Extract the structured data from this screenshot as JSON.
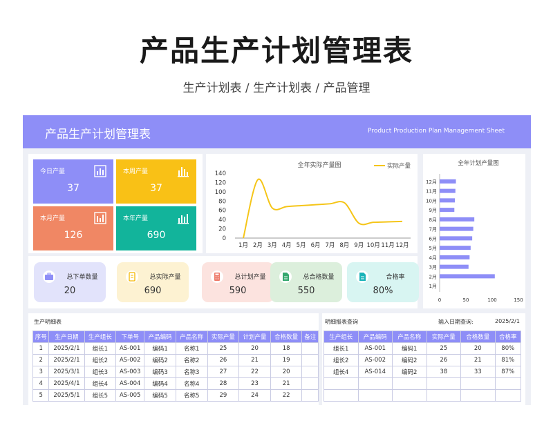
{
  "page": {
    "title": "产品生产计划管理表",
    "breadcrumb": [
      "生产计划表",
      "/",
      "生产计划表",
      "/",
      "产品管理"
    ]
  },
  "banner": {
    "title": "产品生产计划管理表",
    "subtitle": "Product Production Plan Management Sheet"
  },
  "stats": [
    {
      "label": "今日产量",
      "value": "37",
      "color": "#8e8ef7"
    },
    {
      "label": "本周产量",
      "value": "37",
      "color": "#f9c116"
    },
    {
      "label": "本月产量",
      "value": "126",
      "color": "#f08764"
    },
    {
      "label": "本年产量",
      "value": "690",
      "color": "#12b49b"
    }
  ],
  "kpis": [
    {
      "label": "总下单数量",
      "value": "20",
      "bg": "#e2e3fb",
      "icon_color": "#8e8ef7",
      "icon": "briefcase-icon"
    },
    {
      "label": "总实际产量",
      "value": "690",
      "bg": "#fdf2d2",
      "icon_color": "#f5b800",
      "icon": "document-icon"
    },
    {
      "label": "总计划产量",
      "value": "590",
      "bg": "#fce3df",
      "icon_color": "#ee7a6a",
      "icon": "calculator-icon"
    },
    {
      "label": "总合格数量",
      "value": "550",
      "bg": "#dcefdc",
      "icon_color": "#36a86f",
      "icon": "file-icon"
    },
    {
      "label": "合格率",
      "value": "80%",
      "bg": "#d8f5f2",
      "icon_color": "#1ab3b8",
      "icon": "file-icon"
    }
  ],
  "chart_data": [
    {
      "type": "line",
      "title": "全年实际产量图",
      "legend": "实际产量",
      "legend_position": "top-right",
      "color": "#f5c518",
      "x": [
        "1月",
        "2月",
        "3月",
        "4月",
        "5月",
        "6月",
        "7月",
        "8月",
        "9月",
        "10月",
        "11月",
        "12月"
      ],
      "values": [
        0,
        126,
        65,
        68,
        70,
        72,
        74,
        76,
        32,
        34,
        35,
        36
      ],
      "ylim": [
        0,
        140
      ],
      "yticks": [
        0,
        20,
        40,
        60,
        80,
        100,
        120,
        140
      ]
    },
    {
      "type": "bar",
      "orientation": "horizontal",
      "title": "全年计划产量图",
      "color": "#8e8ef7",
      "categories": [
        "1月",
        "2月",
        "3月",
        "4月",
        "5月",
        "6月",
        "7月",
        "8月",
        "9月",
        "10月",
        "11月",
        "12月"
      ],
      "values": [
        0,
        105,
        55,
        57,
        59,
        62,
        64,
        66,
        28,
        29,
        30,
        31
      ],
      "xlim": [
        0,
        150
      ],
      "xticks": [
        0,
        50,
        100,
        150
      ]
    }
  ],
  "detail": {
    "title": "生产明细表",
    "headers": [
      "序号",
      "生产日期",
      "生产组长",
      "下单号",
      "产品编码",
      "产品名称",
      "实际产量",
      "计划产量",
      "合格数量",
      "备注"
    ],
    "rows": [
      [
        "1",
        "2025/2/1",
        "组长1",
        "AS-001",
        "编码1",
        "名称1",
        "25",
        "20",
        "18",
        ""
      ],
      [
        "2",
        "2025/2/1",
        "组长2",
        "AS-002",
        "编码2",
        "名称2",
        "26",
        "21",
        "19",
        ""
      ],
      [
        "3",
        "2025/3/1",
        "组长3",
        "AS-003",
        "编码3",
        "名称3",
        "27",
        "22",
        "20",
        ""
      ],
      [
        "4",
        "2025/4/1",
        "组长4",
        "AS-004",
        "编码4",
        "名称4",
        "28",
        "23",
        "21",
        ""
      ],
      [
        "5",
        "2025/5/1",
        "组长5",
        "AS-005",
        "编码5",
        "名称5",
        "29",
        "24",
        "22",
        ""
      ]
    ]
  },
  "query": {
    "title": "明细报表查询",
    "date_label": "输入日期查询:",
    "date_value": "2025/2/1",
    "headers": [
      "生产组长",
      "产品编码",
      "产品名称",
      "实际产量",
      "合格数量",
      "合格率"
    ],
    "rows": [
      [
        "组长1",
        "AS-001",
        "编码1",
        "25",
        "20",
        "80%"
      ],
      [
        "组长2",
        "AS-002",
        "编码2",
        "26",
        "21",
        "81%"
      ],
      [
        "组长4",
        "AS-014",
        "编码2",
        "38",
        "33",
        "87%"
      ],
      [
        "",
        "",
        "",
        "",
        "",
        ""
      ],
      [
        "",
        "",
        "",
        "",
        "",
        ""
      ]
    ]
  }
}
